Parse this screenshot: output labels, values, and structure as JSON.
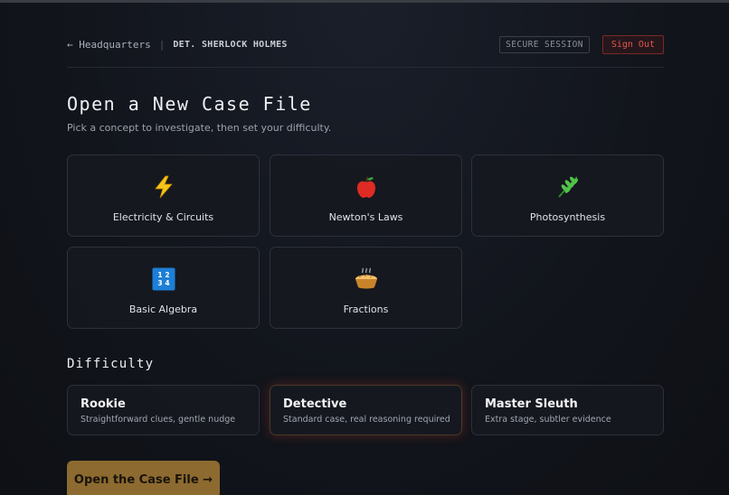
{
  "header": {
    "back_label": "← Headquarters",
    "separator": "|",
    "agent_name": "DET. SHERLOCK HOLMES",
    "secure_badge": "SECURE SESSION",
    "signout_label": "Sign Out"
  },
  "page": {
    "title": "Open a New Case File",
    "subtitle": "Pick a concept to investigate, then set your difficulty."
  },
  "concepts": [
    {
      "label": "Electricity & Circuits",
      "icon": "lightning-icon"
    },
    {
      "label": "Newton's Laws",
      "icon": "apple-icon"
    },
    {
      "label": "Photosynthesis",
      "icon": "herb-icon"
    },
    {
      "label": "Basic Algebra",
      "icon": "numbers-icon"
    },
    {
      "label": "Fractions",
      "icon": "pie-icon"
    }
  ],
  "difficulty": {
    "title": "Difficulty",
    "selected": "Detective",
    "options": [
      {
        "name": "Rookie",
        "desc": "Straightforward clues, gentle nudge"
      },
      {
        "name": "Detective",
        "desc": "Standard case, real reasoning required"
      },
      {
        "name": "Master Sleuth",
        "desc": "Extra stage, subtler evidence"
      }
    ]
  },
  "cta": {
    "label": "Open the Case File →"
  },
  "colors": {
    "accent": "#8c6a30",
    "danger": "#e2574c",
    "background": "#12151c"
  }
}
